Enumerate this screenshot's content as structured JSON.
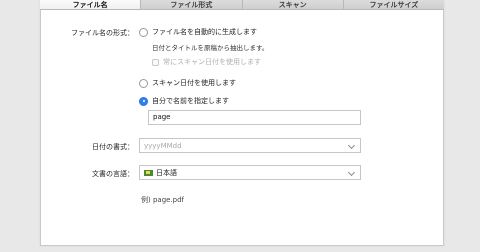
{
  "tabs": [
    {
      "label": "ファイル名",
      "active": true
    },
    {
      "label": "ファイル形式",
      "active": false
    },
    {
      "label": "スキャン",
      "active": false
    },
    {
      "label": "ファイルサイズ",
      "active": false
    }
  ],
  "filename_format": {
    "label": "ファイル名の形式：",
    "option_auto": "ファイル名を自動的に生成します",
    "option_auto_desc": "日付とタイトルを原稿から抽出します。",
    "option_auto_sub": "常にスキャン日付を使用します",
    "option_scan_date": "スキャン日付を使用します",
    "option_custom": "自分で名前を指定します",
    "custom_value": "page",
    "selected": "custom"
  },
  "date_format": {
    "label": "日付の書式：",
    "placeholder": "yyyyMMdd"
  },
  "doc_language": {
    "label": "文書の言語：",
    "value": "日本語"
  },
  "example": "例) page.pdf"
}
